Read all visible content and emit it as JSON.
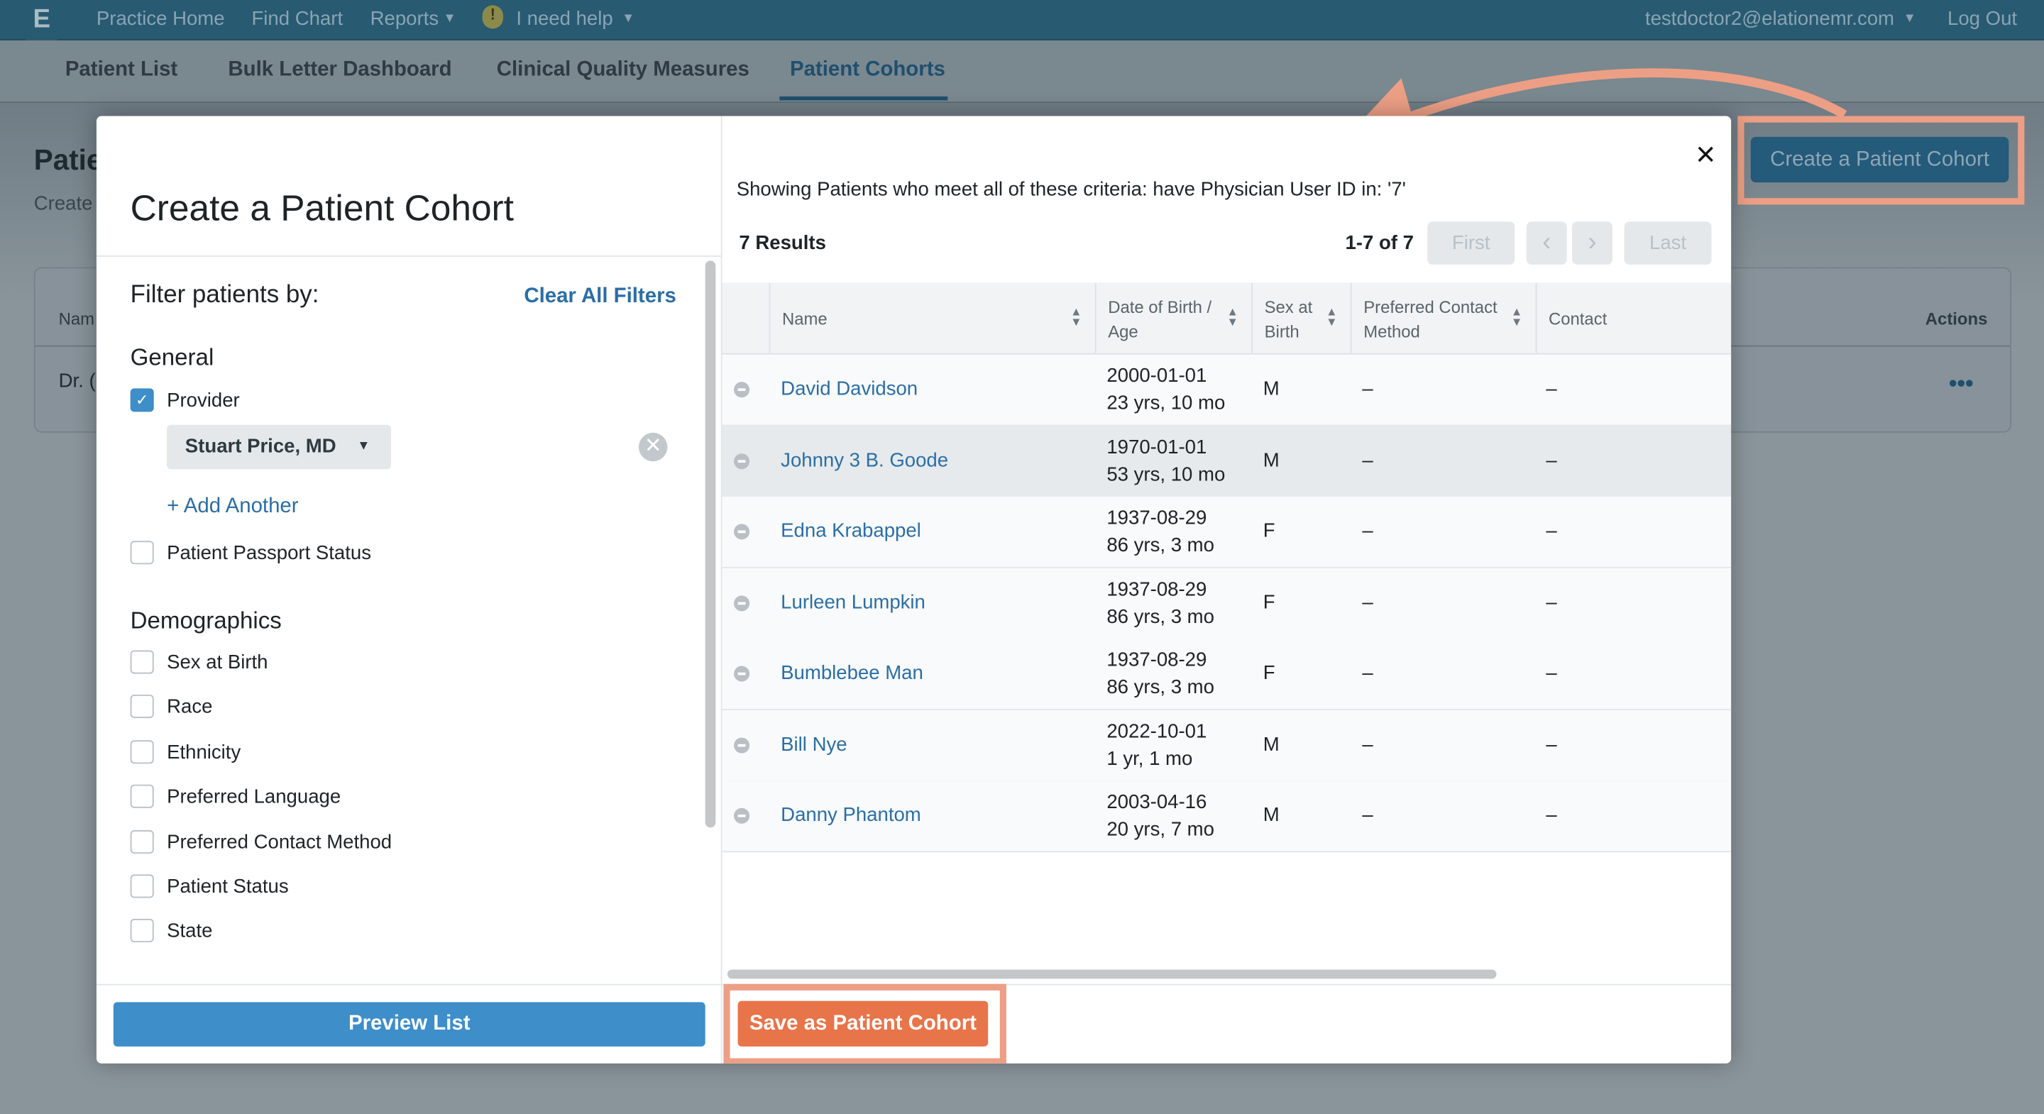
{
  "topnav": {
    "logo": "E",
    "items": [
      "Practice Home",
      "Find Chart",
      "Reports",
      "I need help"
    ],
    "user": "testdoctor2@elationemr.com",
    "logout": "Log Out"
  },
  "subnav": {
    "tabs": [
      "Patient List",
      "Bulk Letter Dashboard",
      "Clinical Quality Measures",
      "Patient Cohorts"
    ],
    "active": "Patient Cohorts"
  },
  "background": {
    "title": "Patie",
    "subtitle": "Create",
    "col_name": "Nam",
    "row_name": "Dr. (",
    "col_actions": "Actions",
    "create_button": "Create a Patient Cohort"
  },
  "modal": {
    "title": "Create a Patient Cohort",
    "filter_heading": "Filter patients by:",
    "clear_all": "Clear All Filters",
    "general": {
      "heading": "General",
      "provider_label": "Provider",
      "provider_checked": true,
      "provider_value": "Stuart Price, MD",
      "add_another": "+ Add Another",
      "passport_label": "Patient Passport Status"
    },
    "demographics": {
      "heading": "Demographics",
      "items": [
        "Sex at Birth",
        "Race",
        "Ethnicity",
        "Preferred Language",
        "Preferred Contact Method",
        "Patient Status",
        "State"
      ]
    },
    "preview_button": "Preview List",
    "criteria": "Showing Patients who meet all of these criteria: have Physician User ID in: '7'",
    "results_count": "7 Results",
    "pagination": {
      "range": "1-7",
      "of": "of 7",
      "first": "First",
      "prev": "‹",
      "next": "›",
      "last": "Last"
    },
    "columns": [
      "Name",
      "Date of Birth / Age",
      "Sex at Birth",
      "Preferred Contact Method",
      "Contact"
    ],
    "rows": [
      {
        "name": "David Davidson",
        "dob": "2000-01-01",
        "age": "23 yrs, 10 mo",
        "sex": "M",
        "pref": "–",
        "contact": "–"
      },
      {
        "name": "Johnny 3 B. Goode",
        "dob": "1970-01-01",
        "age": "53 yrs, 10 mo",
        "sex": "M",
        "pref": "–",
        "contact": "–"
      },
      {
        "name": "Edna Krabappel",
        "dob": "1937-08-29",
        "age": "86 yrs, 3 mo",
        "sex": "F",
        "pref": "–",
        "contact": "–"
      },
      {
        "name": "Lurleen Lumpkin",
        "dob": "1937-08-29",
        "age": "86 yrs, 3 mo",
        "sex": "F",
        "pref": "–",
        "contact": "–"
      },
      {
        "name": "Bumblebee Man",
        "dob": "1937-08-29",
        "age": "86 yrs, 3 mo",
        "sex": "F",
        "pref": "–",
        "contact": "–"
      },
      {
        "name": "Bill Nye",
        "dob": "2022-10-01",
        "age": "1 yr, 1 mo",
        "sex": "M",
        "pref": "–",
        "contact": "–"
      },
      {
        "name": "Danny Phantom",
        "dob": "2003-04-16",
        "age": "20 yrs, 7 mo",
        "sex": "M",
        "pref": "–",
        "contact": "–"
      }
    ],
    "save_button": "Save as Patient Cohort",
    "close": "×"
  },
  "colors": {
    "primary": "#3d8ec9",
    "save": "#e8744a",
    "highlight": "#ec9f85",
    "link": "#2b6ea5"
  }
}
